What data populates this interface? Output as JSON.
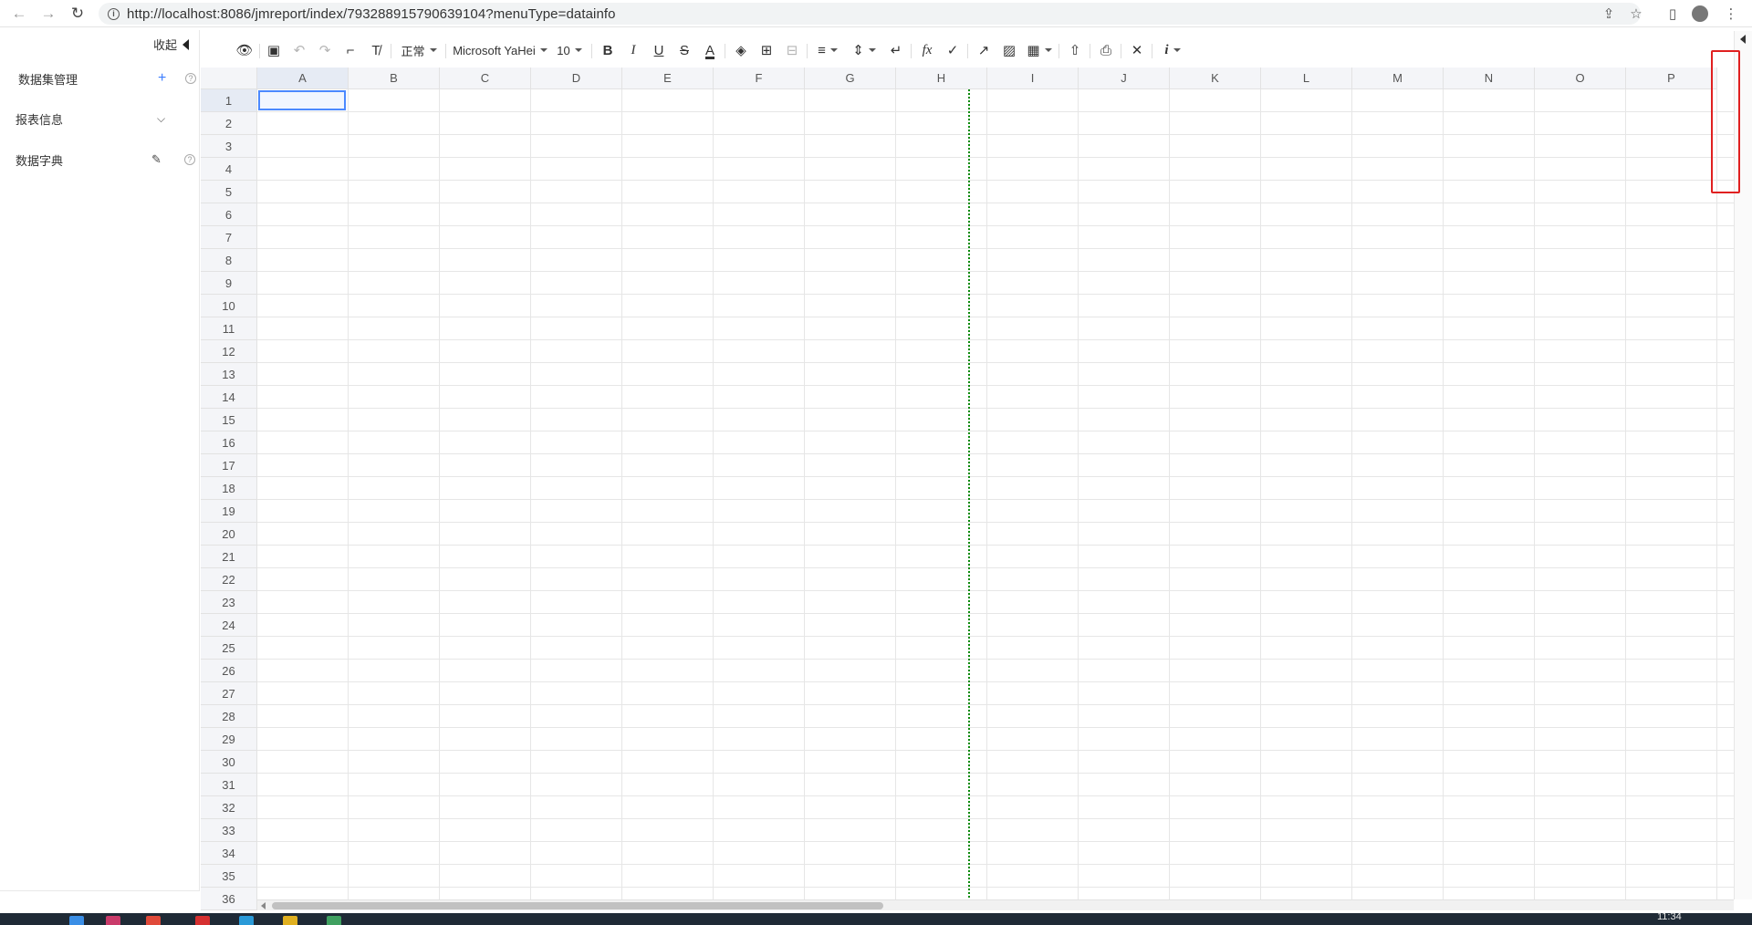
{
  "browser": {
    "url": "http://localhost:8086/jmreport/index/793288915790639104?menuType=datainfo"
  },
  "sidebar": {
    "collapse_label": "收起",
    "items": [
      {
        "label": "数据集管理",
        "action_icon": "plus-icon"
      },
      {
        "label": "报表信息",
        "action_icon": "chevron-down-icon"
      },
      {
        "label": "数据字典",
        "action_icon": "pencil-icon"
      }
    ]
  },
  "toolbar": {
    "style_label": "正常",
    "font_label": "Microsoft YaHei",
    "size_label": "10",
    "fx_label": "fx"
  },
  "sheet": {
    "columns": [
      "A",
      "B",
      "C",
      "D",
      "E",
      "F",
      "G",
      "H",
      "I",
      "J",
      "K",
      "L",
      "M",
      "N",
      "O",
      "P"
    ],
    "rows": [
      "1",
      "2",
      "3",
      "4",
      "5",
      "6",
      "7",
      "8",
      "9",
      "10",
      "11",
      "12",
      "13",
      "14",
      "15",
      "16",
      "17",
      "18",
      "19",
      "20",
      "21",
      "22",
      "23",
      "24",
      "25",
      "26",
      "27",
      "28",
      "29",
      "30",
      "31",
      "32",
      "33",
      "34",
      "35",
      "36"
    ],
    "selected_cell": "A1"
  },
  "colors": {
    "page_break": "#0a8a0a",
    "selection": "#4b89ff",
    "highlight": "#e02020"
  },
  "taskbar": {
    "clock": "11:34"
  }
}
